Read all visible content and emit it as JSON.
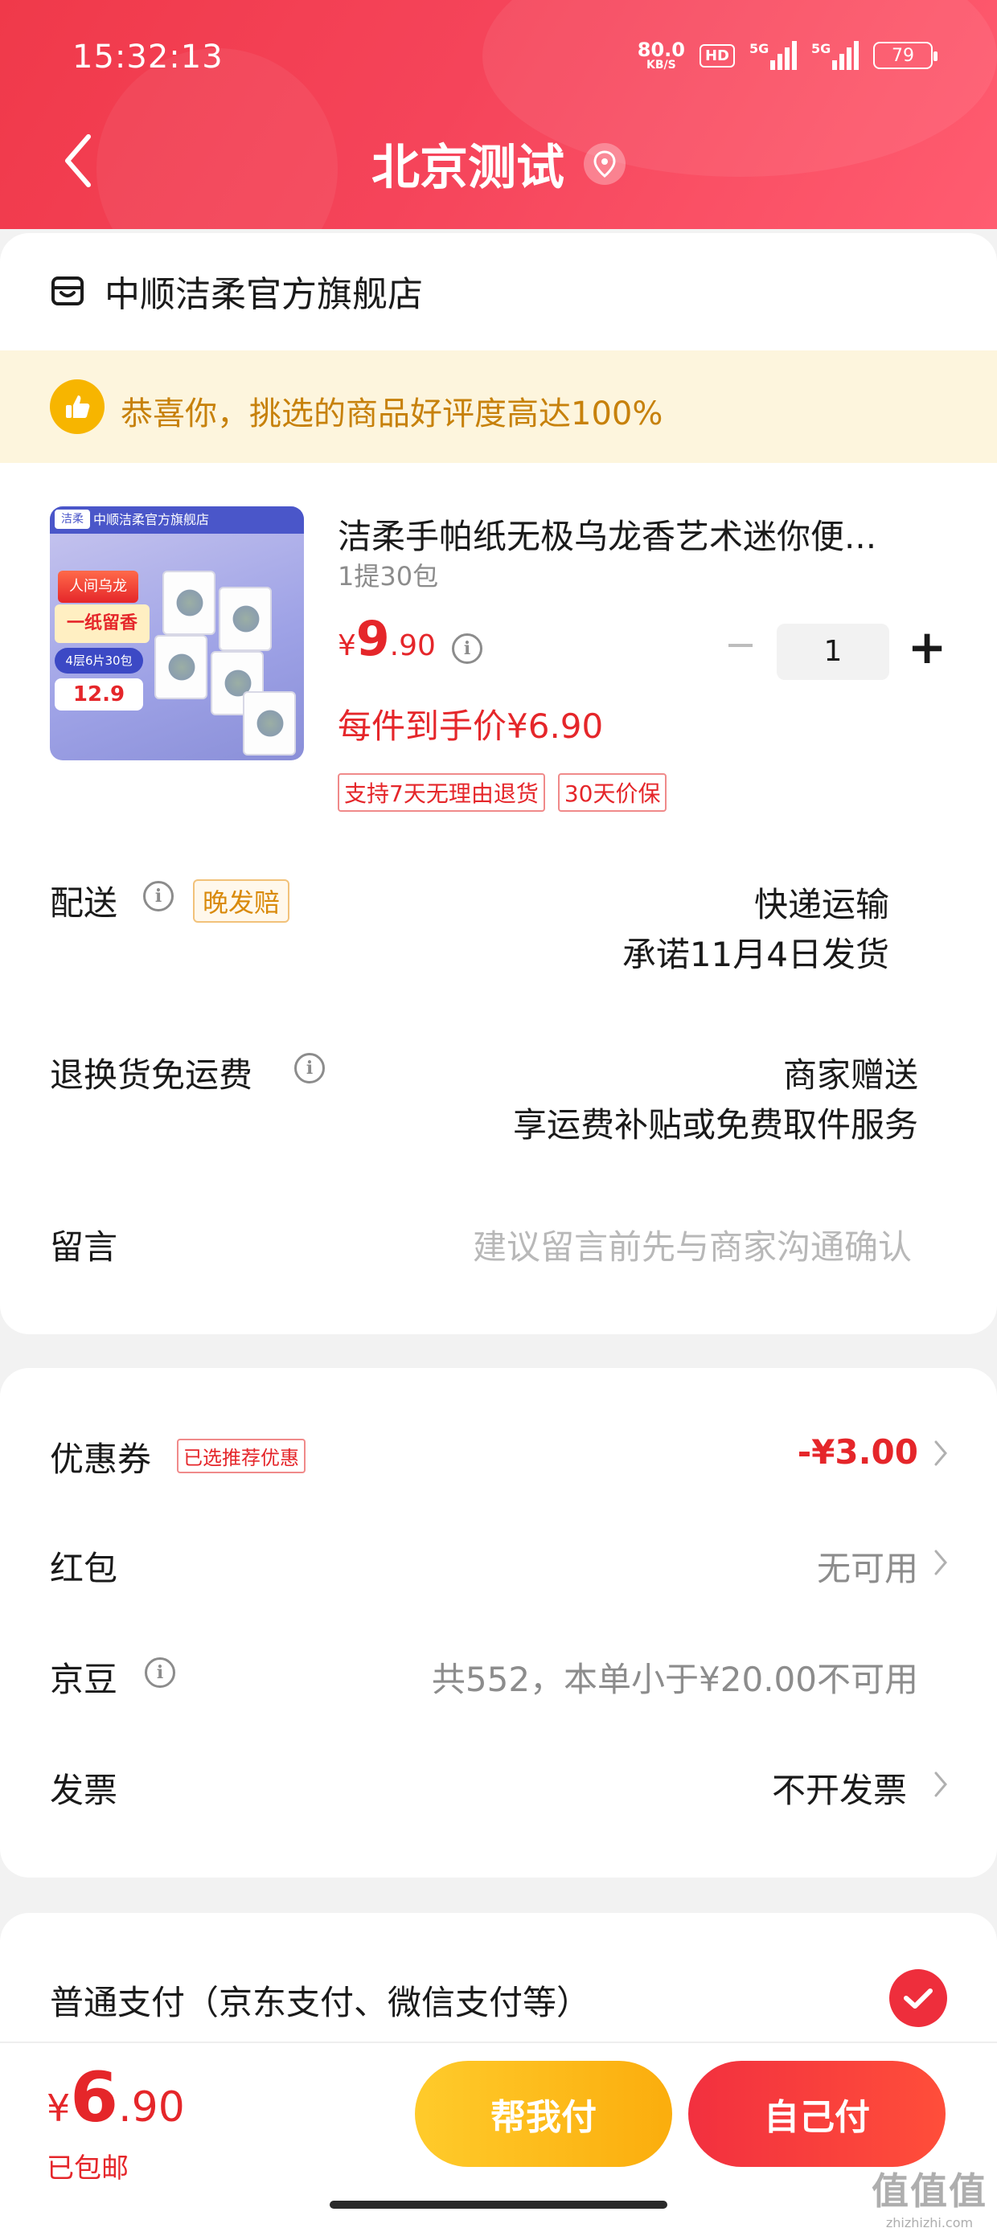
{
  "status_bar": {
    "time": "15:32:13",
    "net_speed": "80.0",
    "net_unit": "KB/S",
    "hd_label": "HD",
    "signal1_label": "5G",
    "signal2_label": "5G",
    "battery": "79"
  },
  "nav": {
    "title": "北京测试",
    "back_icon": "chevron-left-icon",
    "location_icon": "location-pin-icon"
  },
  "store": {
    "name": "中顺洁柔官方旗舰店",
    "icon": "store-icon"
  },
  "praise": {
    "text": "恭喜你，挑选的商品好评度高达100%",
    "icon": "thumbs-up-icon"
  },
  "product": {
    "image_store_label": "中顺洁柔官方旗舰店",
    "image_logo": "洁柔",
    "image_banner1": "人间乌龙",
    "image_banner2": "一纸留香",
    "image_banner3": "4层6片30包",
    "image_price": "12.9",
    "title": "洁柔手帕纸无极乌龙香艺术迷你便...",
    "spec": "1提30包",
    "price_currency": "¥",
    "price_int": "9",
    "price_dec": ".90",
    "quantity": "1",
    "each_price": "每件到手价¥6.90",
    "tags": [
      "支持7天无理由退货",
      "30天价保"
    ]
  },
  "delivery": {
    "label": "配送",
    "badge": "晚发赔",
    "method": "快递运输",
    "promise": "承诺11月4日发货"
  },
  "return_shipping": {
    "label": "退换货免运费",
    "value": "商家赠送",
    "detail": "享运费补贴或免费取件服务"
  },
  "memo": {
    "label": "留言",
    "placeholder": "建议留言前先与商家沟通确认"
  },
  "discounts": {
    "coupon_label": "优惠券",
    "coupon_badge": "已选推荐优惠",
    "coupon_value": "-¥3.00",
    "redpacket_label": "红包",
    "redpacket_value": "无可用",
    "jingdou_label": "京豆",
    "jingdou_value": "共552，本单小于¥20.00不可用",
    "invoice_label": "发票",
    "invoice_value": "不开发票"
  },
  "payment": {
    "label": "普通支付（京东支付、微信支付等）",
    "selected": true
  },
  "bottom": {
    "total_currency": "¥",
    "total_int": "6",
    "total_dec": ".90",
    "free_shipping": "已包邮",
    "help_pay": "帮我付",
    "self_pay": "自己付"
  },
  "watermark": {
    "main": "值值值",
    "sub": "zhizhizhi.com"
  },
  "colors": {
    "accent_red": "#e5262a",
    "header_red": "#f0394a",
    "gold": "#fbad0d"
  }
}
